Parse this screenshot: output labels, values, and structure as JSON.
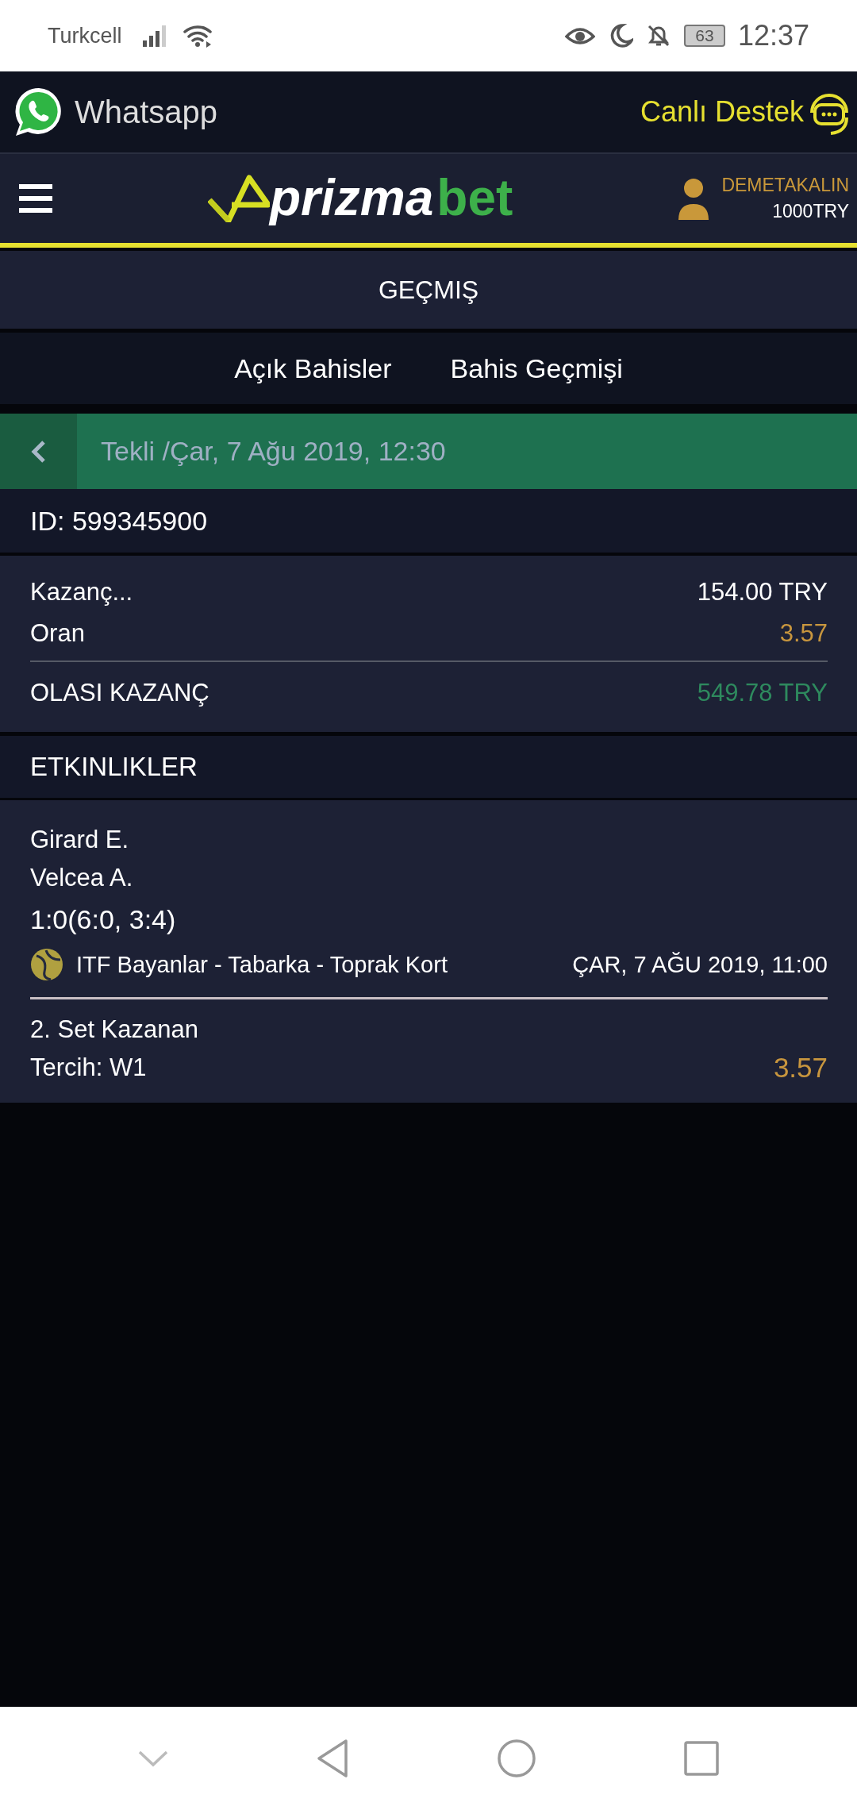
{
  "status_bar": {
    "carrier": "Turkcell",
    "battery": "63",
    "time": "12:37"
  },
  "top_bar": {
    "whatsapp": "Whatsapp",
    "support": "Canlı Destek"
  },
  "header": {
    "logo": {
      "part_1": "prizma",
      "part_2": "bet"
    },
    "user": {
      "name": "DEMETAKALIN",
      "balance": "1000TRY"
    }
  },
  "page_title": "GEÇMIŞ",
  "tabs": [
    {
      "label": "Açık Bahisler"
    },
    {
      "label": "Bahis Geçmişi"
    }
  ],
  "bet": {
    "title": "Tekli /Çar, 7 Ağu 2019, 12:30",
    "id": "ID: 599345900",
    "summary": [
      {
        "label": "Kazanç...",
        "value": "154.00 TRY",
        "kind": "stake"
      },
      {
        "label": "Oran",
        "value": "3.57",
        "kind": "odds"
      },
      {
        "label": "OLASI KAZANÇ",
        "value": "549.78 TRY",
        "kind": "win"
      }
    ],
    "events_title": "ETKINLIKLER",
    "events": [
      {
        "team_1": "Girard E.",
        "team_2": "Velcea A.",
        "score": "1:0(6:0, 3:4)",
        "league": "ITF Bayanlar - Tabarka - Toprak Kort",
        "date": "ÇAR, 7 AĞU 2019, 11:00",
        "market": "2. Set Kazanan",
        "pick": "Tercih: W1",
        "odds": "3.57"
      }
    ]
  }
}
